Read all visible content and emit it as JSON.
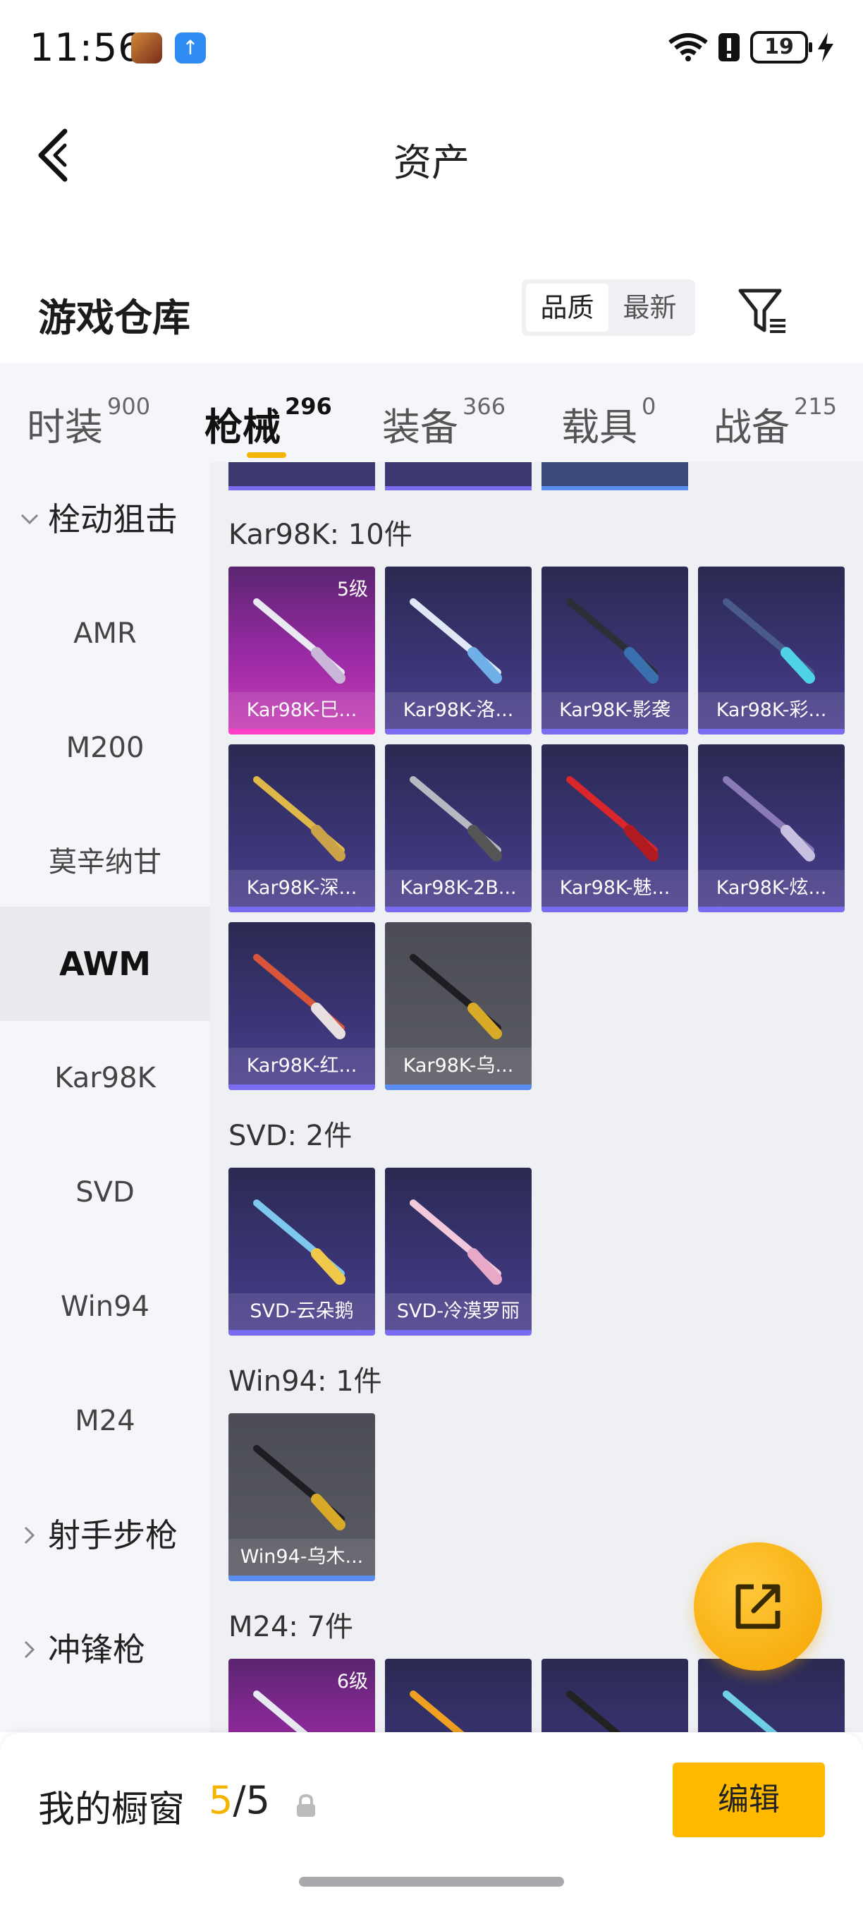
{
  "status_bar": {
    "time": "11:56",
    "battery": "19"
  },
  "header": {
    "title": "资产"
  },
  "warehouse": {
    "title": "游戏仓库",
    "sort_options": [
      "品质",
      "最新"
    ],
    "sort_active": "品质"
  },
  "tabs": [
    {
      "label": "时装",
      "count": "900"
    },
    {
      "label": "枪械",
      "count": "296",
      "active": true
    },
    {
      "label": "装备",
      "count": "366"
    },
    {
      "label": "载具",
      "count": "0"
    },
    {
      "label": "战备",
      "count": "215"
    }
  ],
  "sidebar": {
    "items": [
      {
        "label": "栓动狙击",
        "type": "group",
        "expanded": true
      },
      {
        "label": "AMR"
      },
      {
        "label": "M200"
      },
      {
        "label": "莫辛纳甘"
      },
      {
        "label": "AWM",
        "active": true
      },
      {
        "label": "Kar98K"
      },
      {
        "label": "SVD"
      },
      {
        "label": "Win94"
      },
      {
        "label": "M24"
      },
      {
        "label": "射手步枪",
        "type": "group",
        "expanded": false
      },
      {
        "label": "冲锋枪",
        "type": "group",
        "expanded": false
      }
    ]
  },
  "sections": [
    {
      "title": "Kar98K: 10件",
      "items": [
        {
          "name": "Kar98K-巳...",
          "level": "5级",
          "rarity": "pink"
        },
        {
          "name": "Kar98K-洛...",
          "rarity": "purple"
        },
        {
          "name": "Kar98K-影袭",
          "rarity": "purple"
        },
        {
          "name": "Kar98K-彩...",
          "rarity": "purple"
        },
        {
          "name": "Kar98K-深...",
          "rarity": "purple"
        },
        {
          "name": "Kar98K-2B...",
          "rarity": "purple"
        },
        {
          "name": "Kar98K-魅...",
          "rarity": "purple"
        },
        {
          "name": "Kar98K-炫...",
          "rarity": "purple"
        },
        {
          "name": "Kar98K-红...",
          "rarity": "purple"
        },
        {
          "name": "Kar98K-乌...",
          "rarity": "gray"
        }
      ]
    },
    {
      "title": "SVD: 2件",
      "items": [
        {
          "name": "SVD-云朵鹅",
          "rarity": "purple"
        },
        {
          "name": "SVD-冷漠罗丽",
          "rarity": "purple"
        }
      ]
    },
    {
      "title": "Win94: 1件",
      "items": [
        {
          "name": "Win94-乌木...",
          "rarity": "gray"
        }
      ]
    },
    {
      "title": "M24: 7件",
      "items": [
        {
          "name": "",
          "level": "6级",
          "rarity": "pink"
        },
        {
          "name": "",
          "rarity": "purple"
        },
        {
          "name": "",
          "rarity": "purple"
        },
        {
          "name": "",
          "rarity": "purple"
        }
      ]
    }
  ],
  "bottom_bar": {
    "label": "我的橱窗",
    "current": "5",
    "separator": "/",
    "max": "5",
    "edit_label": "编辑"
  },
  "colors": {
    "accent": "#f5b400",
    "edit_button": "#ffba00"
  },
  "icons": [
    "back-arrow-icon",
    "filter-icon",
    "share-icon",
    "lock-icon",
    "wifi-icon",
    "alert-icon",
    "bolt-icon"
  ]
}
